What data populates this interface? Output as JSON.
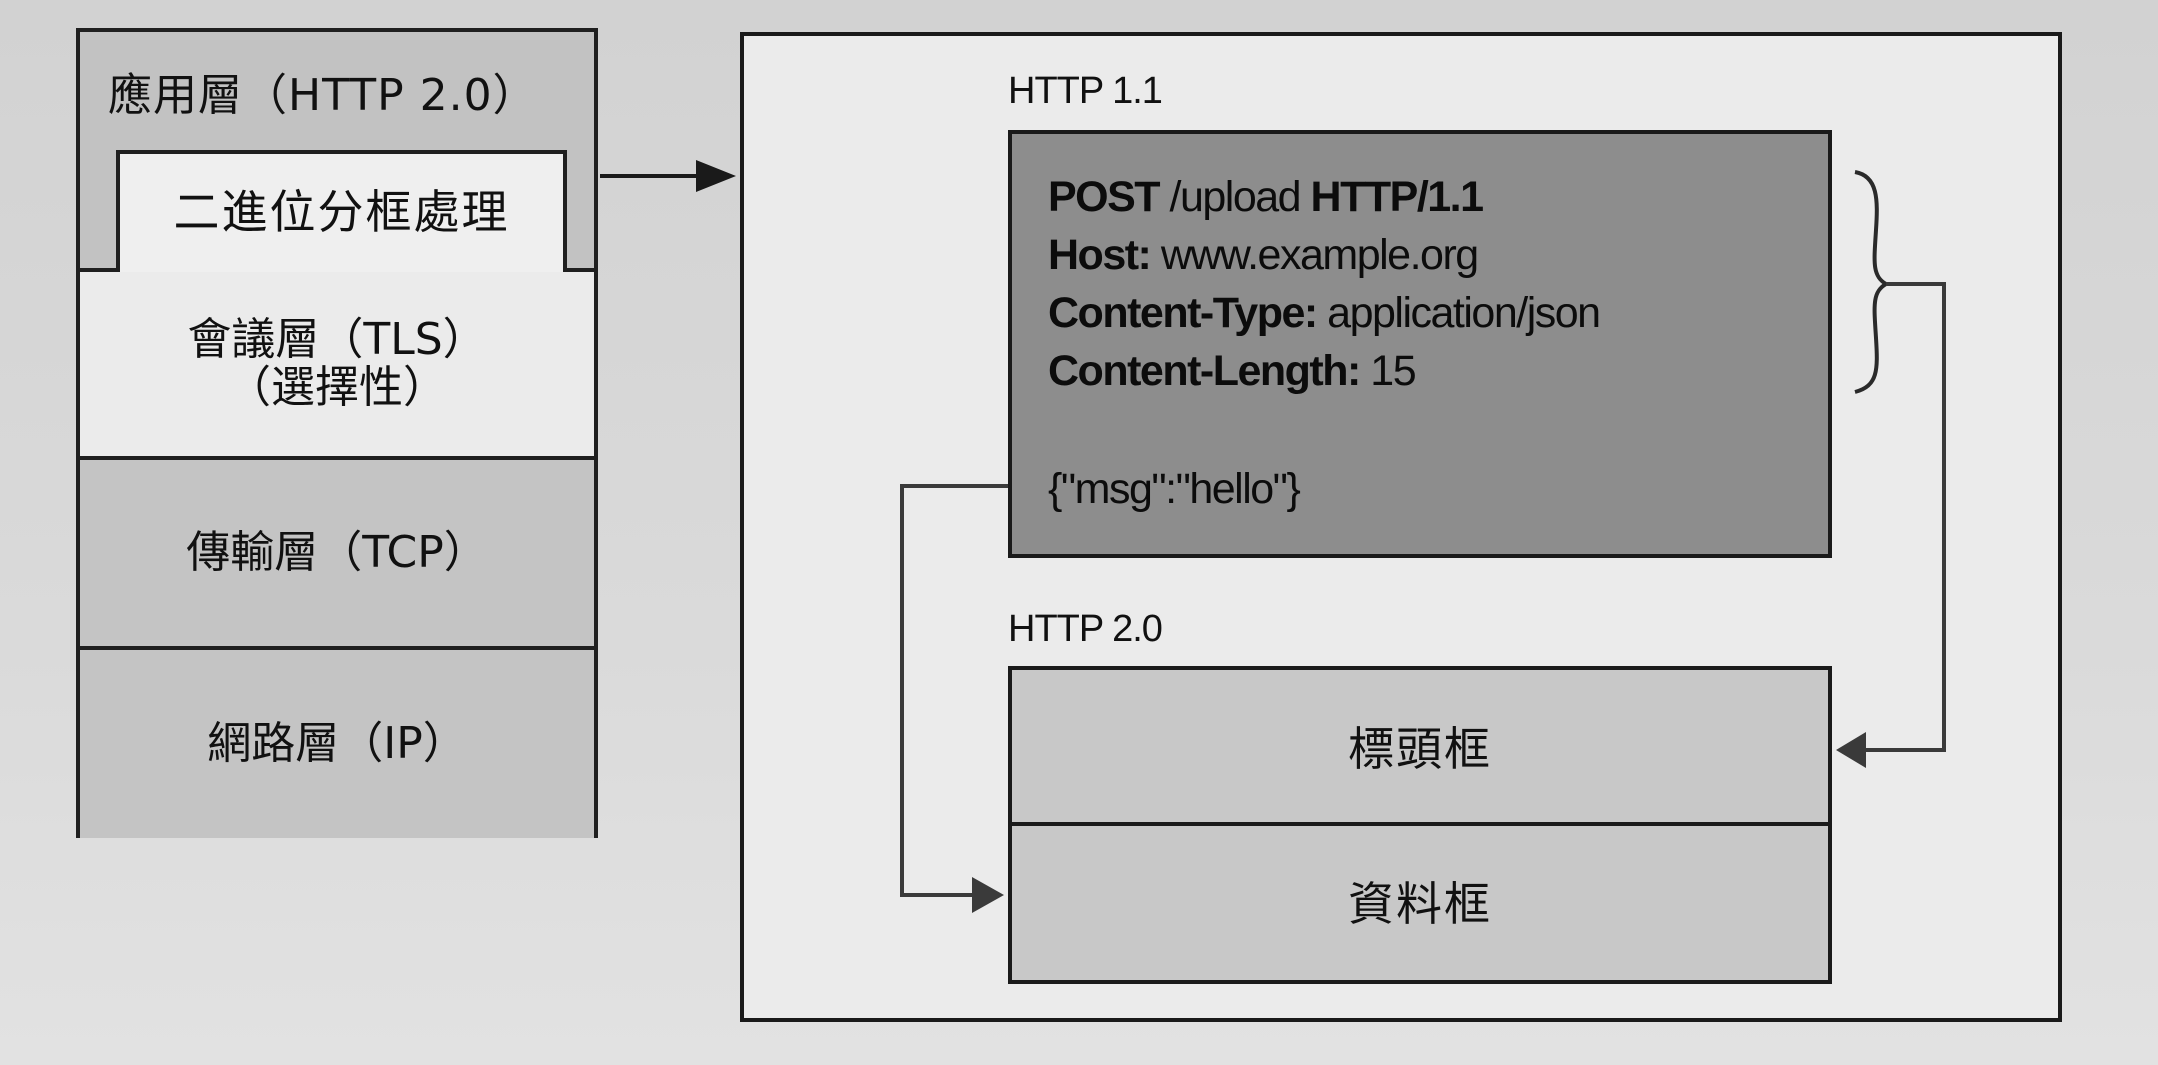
{
  "stack": {
    "app_layer": "應用層（HTTP 2.0）",
    "binary_framing": "二進位分框處理",
    "session_layer_line1": "會議層（TLS）",
    "session_layer_line2": "（選擇性）",
    "transport_layer": "傳輸層（TCP）",
    "network_layer": "網路層（IP）"
  },
  "panel": {
    "http11_label": "HTTP 1.1",
    "http20_label": "HTTP 2.0",
    "request": {
      "line1_bold1": "POST",
      "line1_plain": " /upload ",
      "line1_bold2": "HTTP/1.1",
      "host_key": "Host:",
      "host_val": " www.example.org",
      "ctype_key": "Content-Type:",
      "ctype_val": " application/json",
      "clen_key": "Content-Length:",
      "clen_val": " 15",
      "body": "{\"msg\":\"hello\"}"
    },
    "header_frame": "標頭框",
    "data_frame": "資料框"
  },
  "colors": {
    "line": "#1a1a1a",
    "connector": "#3a3a3a",
    "request_bg": "#8d8d8d",
    "frames_bg": "#c8c8c8"
  }
}
